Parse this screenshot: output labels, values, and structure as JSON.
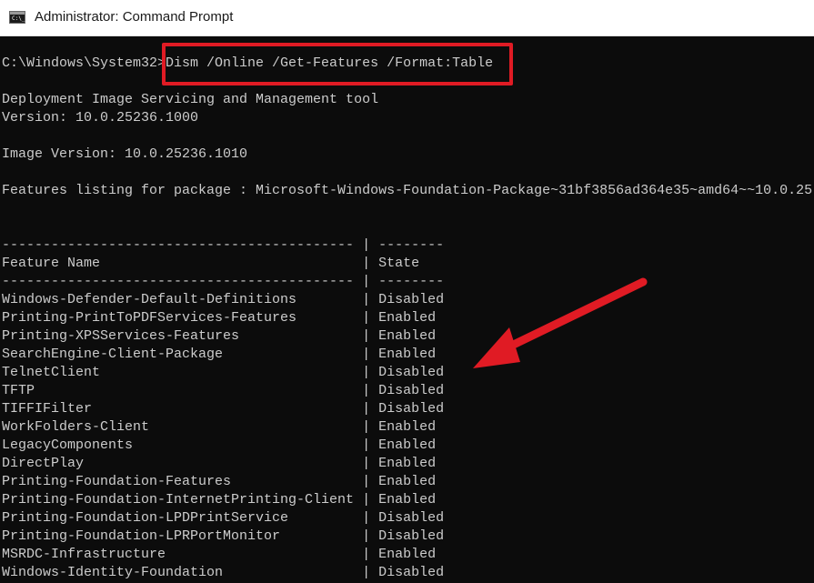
{
  "window": {
    "title": "Administrator: Command Prompt",
    "icon": "cmd-icon",
    "icon_text": "C:\\_"
  },
  "console": {
    "prompt": "C:\\Windows\\System32>",
    "command": "Dism /Online /Get-Features /Format:Table",
    "tool_name": "Deployment Image Servicing and Management tool",
    "version": "Version: 10.0.25236.1000",
    "image_version": "Image Version: 10.0.25236.1010",
    "features_listing": "Features listing for package : Microsoft-Windows-Foundation-Package~31bf3856ad364e35~amd64~~10.0.25",
    "separator": "------------------------------------------- | --------",
    "table_header": {
      "feature_name": "Feature Name",
      "state": "State"
    },
    "features": [
      {
        "name": "Windows-Defender-Default-Definitions",
        "state": "Disabled"
      },
      {
        "name": "Printing-PrintToPDFServices-Features",
        "state": "Enabled"
      },
      {
        "name": "Printing-XPSServices-Features",
        "state": "Enabled"
      },
      {
        "name": "SearchEngine-Client-Package",
        "state": "Enabled"
      },
      {
        "name": "TelnetClient",
        "state": "Disabled"
      },
      {
        "name": "TFTP",
        "state": "Disabled"
      },
      {
        "name": "TIFFIFilter",
        "state": "Disabled"
      },
      {
        "name": "WorkFolders-Client",
        "state": "Enabled"
      },
      {
        "name": "LegacyComponents",
        "state": "Enabled"
      },
      {
        "name": "DirectPlay",
        "state": "Enabled"
      },
      {
        "name": "Printing-Foundation-Features",
        "state": "Enabled"
      },
      {
        "name": "Printing-Foundation-InternetPrinting-Client",
        "state": "Enabled"
      },
      {
        "name": "Printing-Foundation-LPDPrintService",
        "state": "Disabled"
      },
      {
        "name": "Printing-Foundation-LPRPortMonitor",
        "state": "Disabled"
      },
      {
        "name": "MSRDC-Infrastructure",
        "state": "Enabled"
      },
      {
        "name": "Windows-Identity-Foundation",
        "state": "Disabled"
      }
    ]
  },
  "colors": {
    "console_bg": "#0c0c0c",
    "console_text": "#cccccc",
    "annotation": "#e01b24"
  }
}
